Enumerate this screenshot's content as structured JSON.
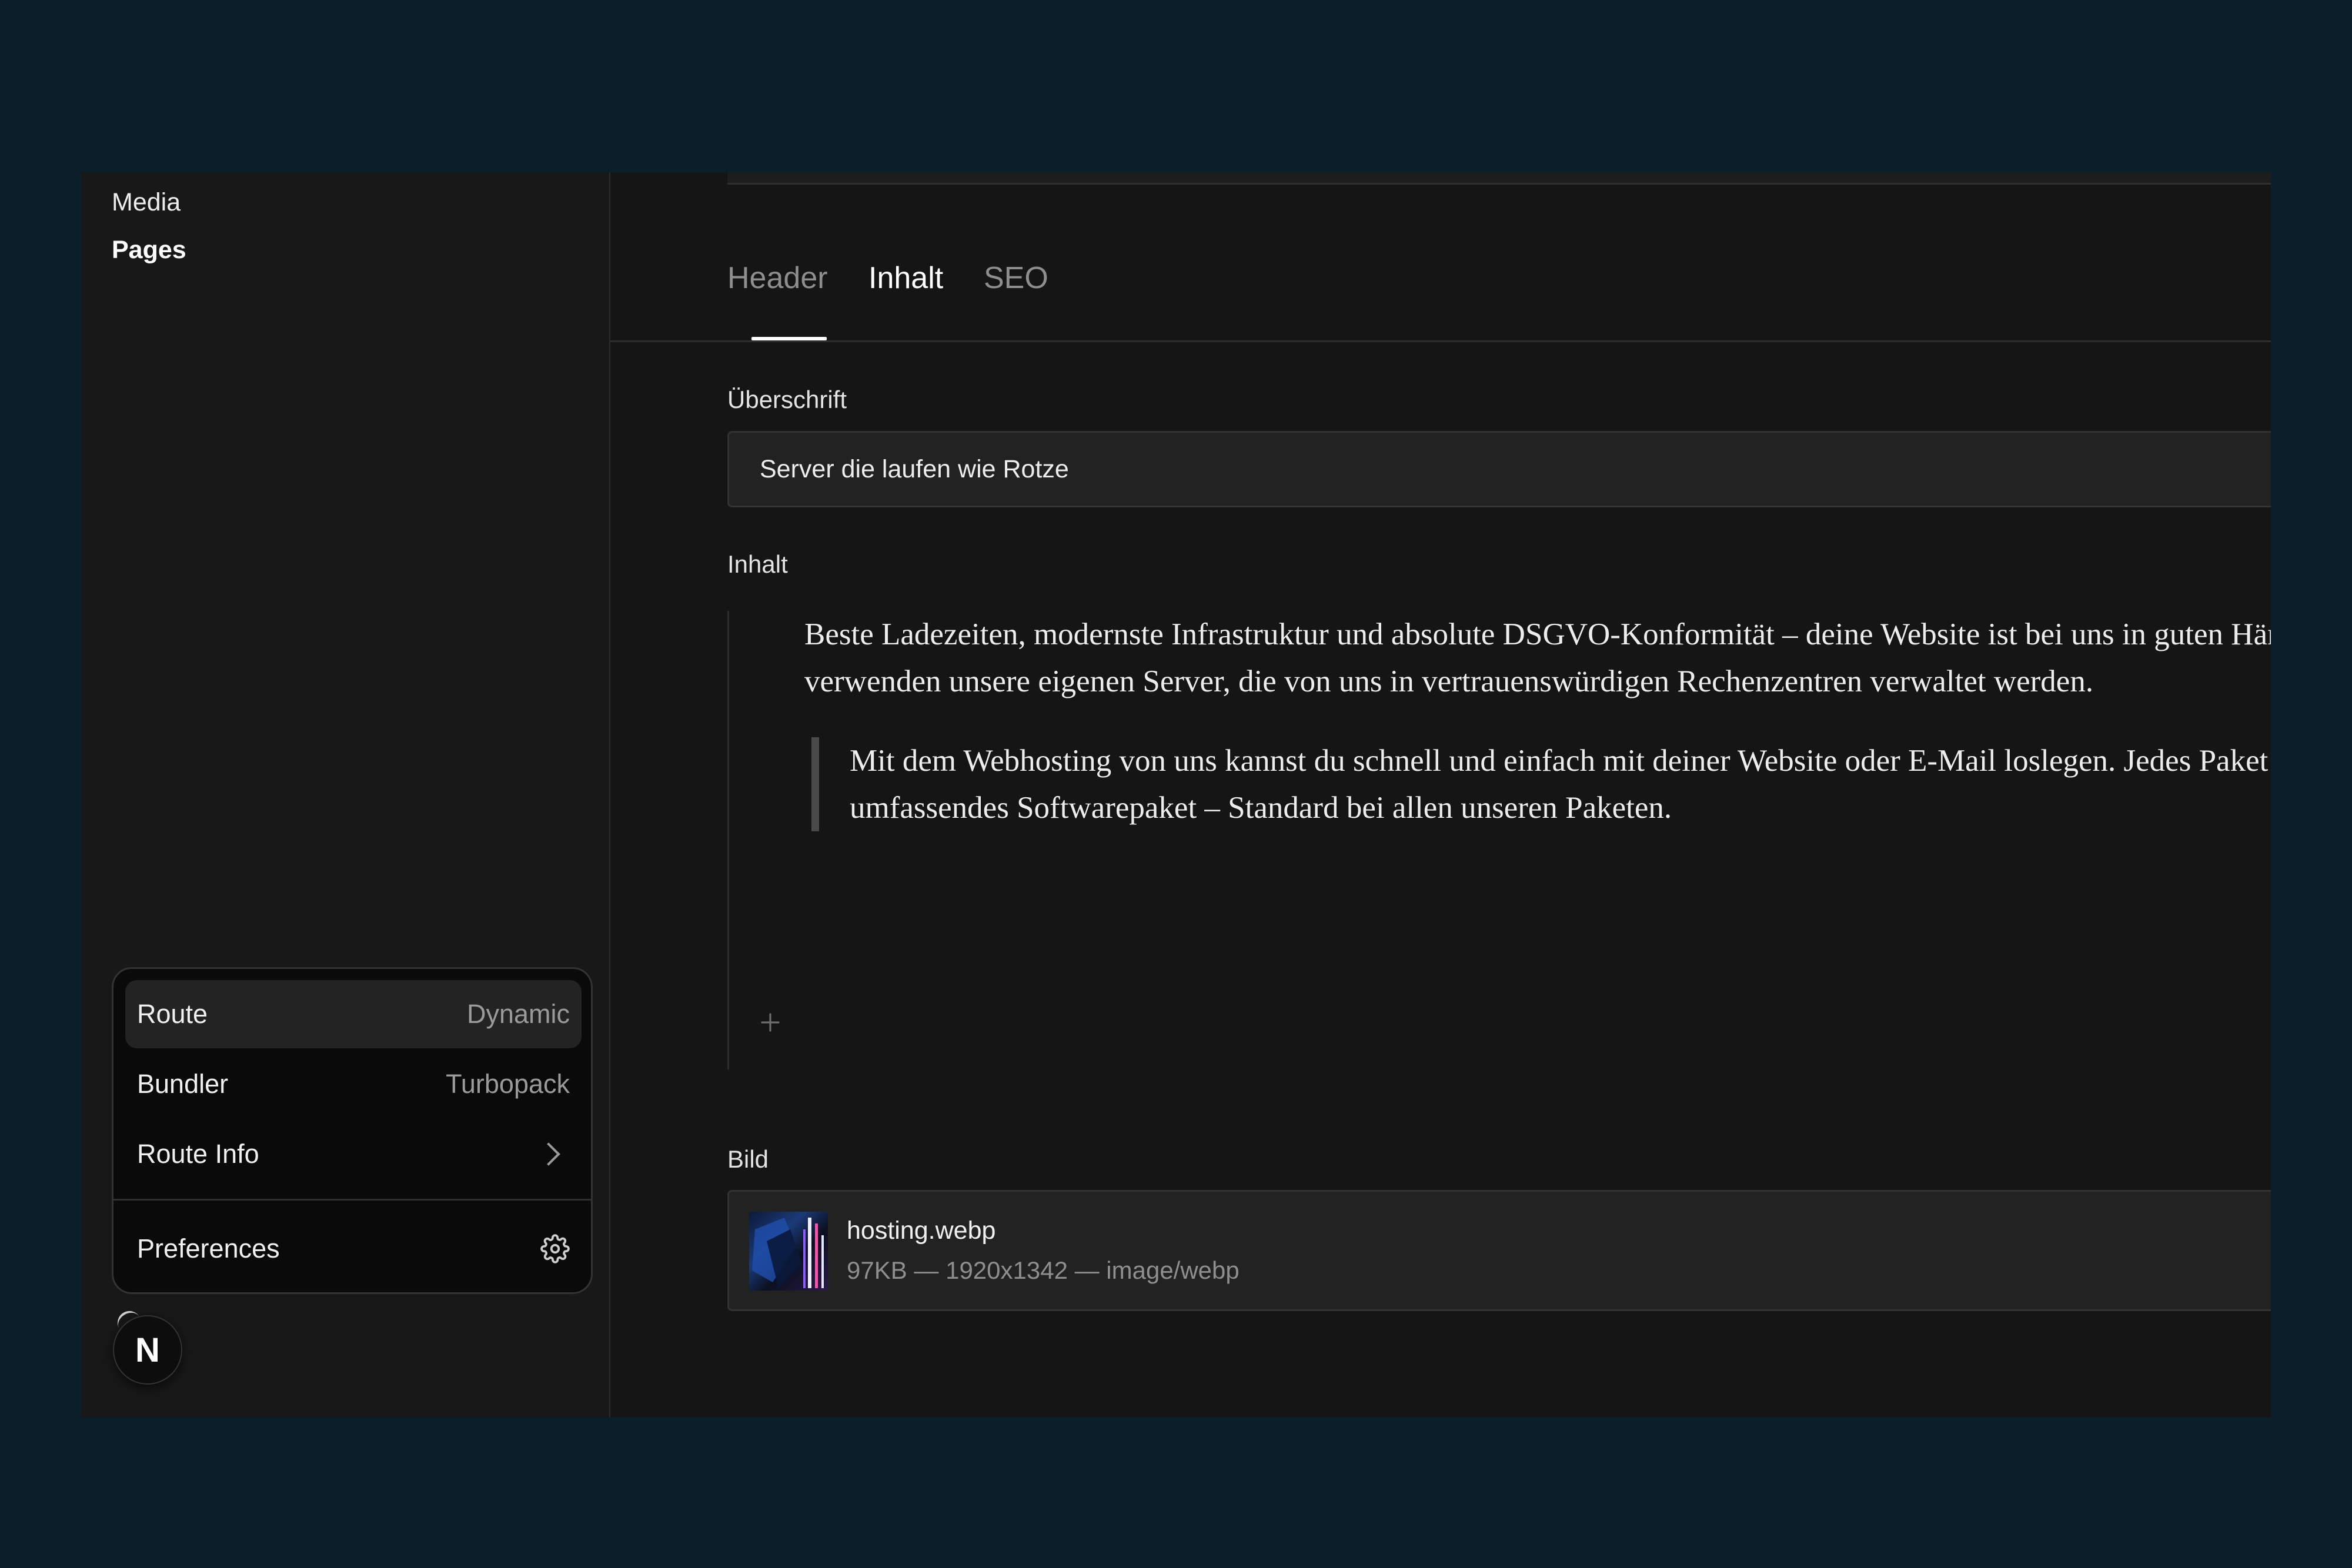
{
  "sidebar": {
    "items": [
      {
        "label": "Media"
      },
      {
        "label": "Pages"
      }
    ]
  },
  "devtools": {
    "route": {
      "label": "Route",
      "value": "Dynamic"
    },
    "bundler": {
      "label": "Bundler",
      "value": "Turbopack"
    },
    "route_info": {
      "label": "Route Info"
    },
    "preferences": {
      "label": "Preferences"
    },
    "badge": {
      "letter": "N"
    }
  },
  "tabs": [
    {
      "label": "Header"
    },
    {
      "label": "Inhalt",
      "active": true
    },
    {
      "label": "SEO"
    }
  ],
  "form": {
    "heading": {
      "label": "Überschrift",
      "value": "Server die laufen wie Rotze"
    },
    "content": {
      "label": "Inhalt",
      "paragraph": "Beste Ladezeiten, modernste Infrastruktur und absolute DSGVO-Konformität – deine Website ist bei uns in guten Händen. Wir verwenden unsere eigenen Server, die von uns in vertrauenswürdigen Rechenzentren verwaltet werden.",
      "quote": "Mit dem Webhosting von uns kannst du schnell und einfach mit deiner Website oder E-Mail loslegen. Jedes Paket enthält ein umfassendes Softwarepaket – Standard bei allen unseren Paketen."
    },
    "image": {
      "label": "Bild",
      "file_name": "hosting.webp",
      "file_meta": "97KB — 1920x1342 — image/webp"
    }
  },
  "icons": {
    "chevron": "chevron-right-icon",
    "gear": "gear-icon",
    "plus": "plus-icon"
  },
  "colors": {
    "backdrop": "#0a1f2a",
    "surface": "#151515",
    "sidebar": "#181818",
    "input": "#222222"
  }
}
